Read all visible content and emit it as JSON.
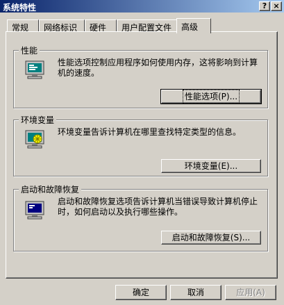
{
  "window": {
    "title": "系统特性",
    "help_btn": "?",
    "close_btn": "×"
  },
  "tabs": [
    {
      "label": "常规"
    },
    {
      "label": "网络标识"
    },
    {
      "label": "硬件"
    },
    {
      "label": "用户配置文件"
    },
    {
      "label": "高级"
    }
  ],
  "performance": {
    "title": "性能",
    "description": "性能选项控制应用程序如何使用内存，这将影响到计算机的速度。",
    "button": "性能选项(P)..."
  },
  "environment": {
    "title": "环境变量",
    "description": "环境变量告诉计算机在哪里查找特定类型的信息。",
    "button": "环境变量(E)..."
  },
  "startup": {
    "title": "启动和故障恢复",
    "description": "启动和故障恢复选项告诉计算机当错误导致计算机停止时，如何启动以及执行哪些操作。",
    "button": "启动和故障恢复(S)..."
  },
  "footer": {
    "ok": "确定",
    "cancel": "取消",
    "apply": "应用(A)"
  },
  "icons": {
    "performance": "monitor-performance-icon",
    "environment": "monitor-environment-icon",
    "startup": "monitor-startup-icon"
  }
}
